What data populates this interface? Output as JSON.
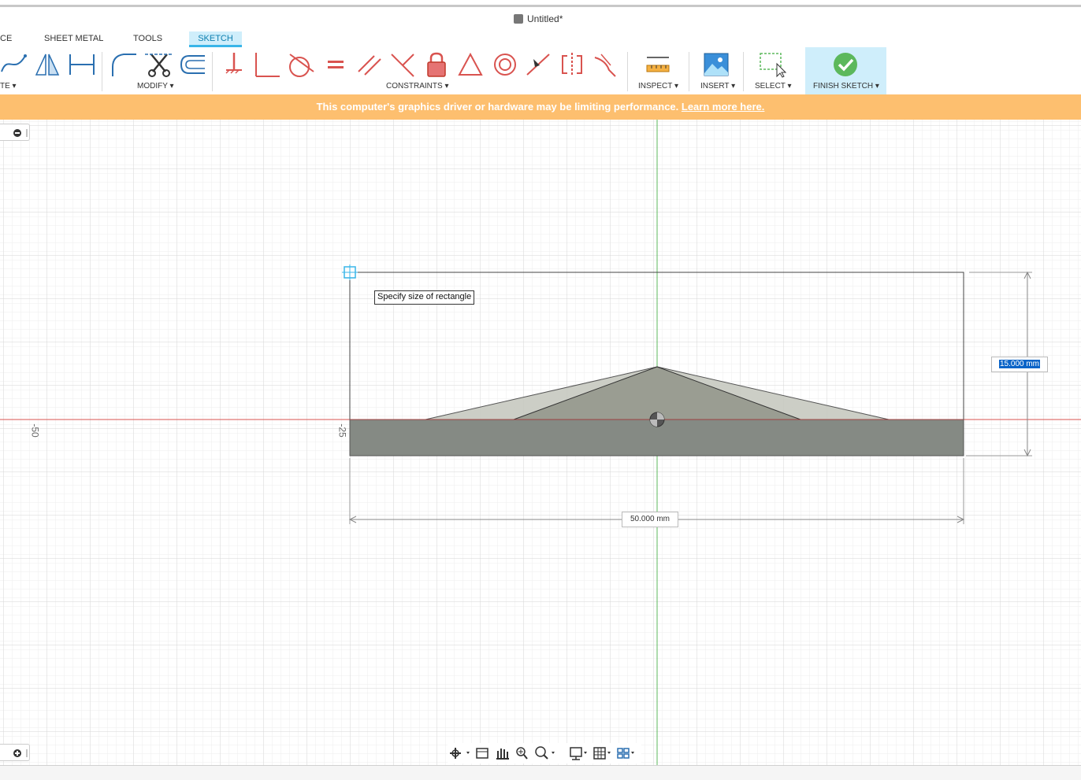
{
  "app": {
    "document_title": "Untitled*"
  },
  "tabs": [
    {
      "label": "CE"
    },
    {
      "label": "SHEET METAL"
    },
    {
      "label": "TOOLS"
    },
    {
      "label": "SKETCH"
    }
  ],
  "toolbar": {
    "groups": {
      "create": "TE ▾",
      "modify": "MODIFY ▾",
      "constraints": "CONSTRAINTS ▾",
      "inspect": "INSPECT ▾",
      "insert": "INSERT ▾",
      "select": "SELECT ▾",
      "finish": "FINISH SKETCH ▾"
    },
    "icons": [
      "spline-icon",
      "mirror-icon",
      "dimension-icon",
      "fillet-icon",
      "trim-icon",
      "offset-icon",
      "fix-icon",
      "coincident-icon",
      "tangent-icon",
      "equal-icon",
      "parallel-icon",
      "perpendicular-icon",
      "lock-icon",
      "triangle-icon",
      "concentric-icon",
      "midpoint-icon",
      "symmetry-icon",
      "curvature-icon",
      "measure-icon",
      "insert-image-icon",
      "window-select-icon",
      "finish-check-icon"
    ]
  },
  "warning": {
    "text": "This computer's graphics driver or hardware may be limiting performance.",
    "link": "Learn more here."
  },
  "sketch": {
    "tooltip": "Specify size of rectangle",
    "width_dimension": "50.000 mm",
    "height_dimension_input": "15.000 mm",
    "axis_labels": [
      "-50",
      "-25"
    ]
  },
  "colors": {
    "accent": "#39b5e8",
    "warning_bg": "#fdbf6f",
    "x_axis": "#d9534f",
    "y_axis": "#5cb85c",
    "finish_check": "#5cb85c",
    "lock": "#d9534f"
  }
}
